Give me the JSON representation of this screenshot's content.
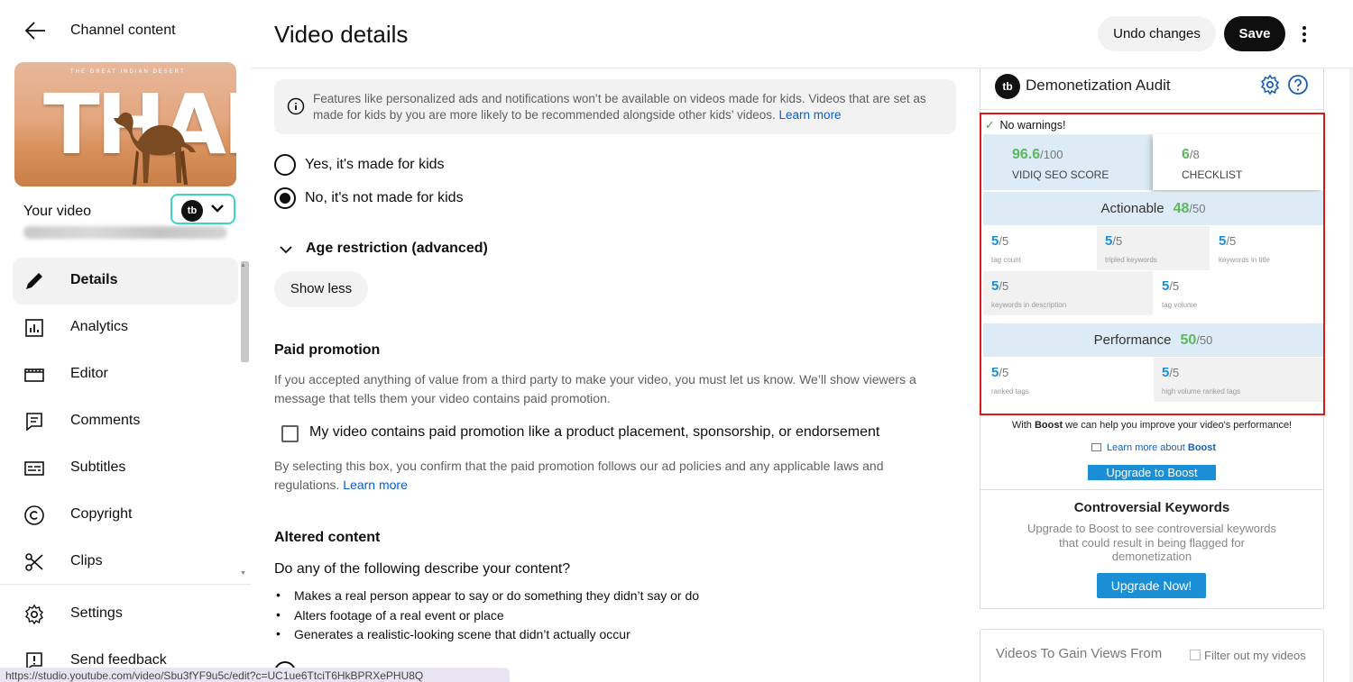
{
  "sidebar": {
    "title": "Channel content",
    "your_video_label": "Your video",
    "thumbnail_text": "THAR",
    "thumbnail_tagline": "THE GREAT INDIAN DESERT",
    "tubebuddy_logo": "tb",
    "nav": [
      {
        "label": "Details",
        "icon": "pencil-icon",
        "active": true
      },
      {
        "label": "Analytics",
        "icon": "analytics-icon"
      },
      {
        "label": "Editor",
        "icon": "editor-icon"
      },
      {
        "label": "Comments",
        "icon": "comments-icon"
      },
      {
        "label": "Subtitles",
        "icon": "subtitles-icon"
      },
      {
        "label": "Copyright",
        "icon": "copyright-icon"
      },
      {
        "label": "Clips",
        "icon": "scissors-icon"
      }
    ],
    "bottom_nav": [
      {
        "label": "Settings",
        "icon": "gear-icon"
      },
      {
        "label": "Send feedback",
        "icon": "feedback-icon"
      }
    ]
  },
  "status_url": "https://studio.youtube.com/video/Sbu3fYF9u5c/edit?c=UC1ue6TtciT6HkBPRXePHU8Q",
  "header": {
    "title": "Video details",
    "undo_label": "Undo changes",
    "save_label": "Save"
  },
  "audience": {
    "info_text": "Features like personalized ads and notifications won’t be available on videos made for kids. Videos that are set as made for kids by you are more likely to be recommended alongside other kids’ videos.",
    "info_link": "Learn more",
    "option_yes": "Yes, it's made for kids",
    "option_no": "No, it's not made for kids",
    "selected": "no",
    "age_restriction": "Age restriction (advanced)",
    "show_less": "Show less"
  },
  "paid_promotion": {
    "heading": "Paid promotion",
    "description": "If you accepted anything of value from a third party to make your video, you must let us know. We’ll show viewers a message that tells them your video contains paid promotion.",
    "checkbox_label": "My video contains paid promotion like a product placement, sponsorship, or endorsement",
    "checked": false,
    "note": "By selecting this box, you confirm that the paid promotion follows our ad policies and any applicable laws and regulations.",
    "note_link": "Learn more"
  },
  "altered_content": {
    "heading": "Altered content",
    "question": "Do any of the following describe your content?",
    "bullets": [
      "Makes a real person appear to say or do something they didn’t say or do",
      "Alters footage of a real event or place",
      "Generates a realistic-looking scene that didn’t actually occur"
    ]
  },
  "audit_panel": {
    "logo": "tb",
    "title": "Demonetization Audit",
    "status": "No warnings!",
    "seo_score": "96.6",
    "seo_score_max": "/100",
    "seo_label": "VIDIQ SEO SCORE",
    "checklist_score": "6",
    "checklist_max": "/8",
    "checklist_label": "CHECKLIST",
    "actionable_label": "Actionable",
    "actionable_score": "48",
    "actionable_max": "/50",
    "actionable_items": [
      {
        "value": "5",
        "max": "/5",
        "label": "tag count"
      },
      {
        "value": "5",
        "max": "/5",
        "label": "tripled keywords"
      },
      {
        "value": "5",
        "max": "/5",
        "label": "keywords in title"
      },
      {
        "value": "5",
        "max": "/5",
        "label": "keywords in description"
      },
      {
        "value": "5",
        "max": "/5",
        "label": "tag volume"
      }
    ],
    "performance_label": "Performance",
    "performance_score": "50",
    "performance_max": "/50",
    "performance_items": [
      {
        "value": "5",
        "max": "/5",
        "label": "ranked tags"
      },
      {
        "value": "5",
        "max": "/5",
        "label": "high volume ranked tags"
      }
    ],
    "boost_text_pre": "With ",
    "boost_text_bold": "Boost",
    "boost_text_post": " we can help you improve your video's performance!",
    "learn_more_pre": "Learn more about ",
    "learn_more_bold": "Boost",
    "upgrade_boost": "Upgrade to Boost",
    "controversial_title": "Controversial Keywords",
    "controversial_text": "Upgrade to Boost to see controversial keywords that could result in being flagged for demonetization",
    "upgrade_now": "Upgrade Now!",
    "accent_color": "#1b8fd6",
    "score_green": "#5cb85c",
    "highlight_border": "#e0161a"
  },
  "videos_gain": {
    "title": "Videos To Gain Views From",
    "filter_label": "Filter out my videos"
  }
}
